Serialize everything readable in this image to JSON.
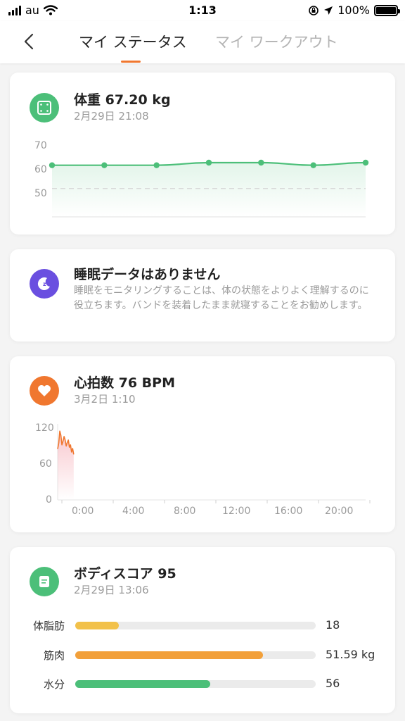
{
  "status_bar": {
    "carrier": "au",
    "time": "1:13",
    "battery_percent": "100%",
    "icons": [
      "signal-icon",
      "wifi-icon",
      "orientation-lock-icon",
      "location-icon",
      "battery-icon"
    ]
  },
  "nav": {
    "back_icon": "chevron-left-icon",
    "tabs": [
      {
        "label": "マイ ステータス",
        "active": true
      },
      {
        "label": "マイ ワークアウト",
        "active": false
      }
    ],
    "accent_color": "#f0772f"
  },
  "weight": {
    "title": "体重 67.20 kg",
    "timestamp": "2月29日 21:08",
    "icon": "scale-icon",
    "color": "#4cbf79",
    "chart_data": {
      "type": "line",
      "yticks": [
        "70",
        "60",
        "50"
      ],
      "ylim": [
        45,
        75
      ],
      "values": [
        65,
        65,
        65,
        66,
        66,
        65,
        66
      ],
      "goal_line": 56
    }
  },
  "sleep": {
    "title": "睡眠データはありません",
    "description": "睡眠をモニタリングすることは、体の状態をよりよく理解するのに役立ちます。バンドを装着したまま就寝することをお勧めします。",
    "icon": "moon-icon",
    "color": "#6a4fe0"
  },
  "heart": {
    "title": "心拍数 76  BPM",
    "timestamp": "3月2日 1:10",
    "icon": "heart-icon",
    "color": "#f0772f",
    "chart_data": {
      "type": "area",
      "yticks": [
        "120",
        "60",
        "0"
      ],
      "ylim": [
        0,
        120
      ],
      "xticks": [
        "0:00",
        "4:00",
        "8:00",
        "12:00",
        "16:00",
        "20:00"
      ],
      "x_minutes": [
        0,
        5,
        10,
        15,
        20,
        25,
        30,
        35,
        40,
        45,
        50,
        55,
        60,
        65,
        70,
        75
      ],
      "values": [
        85,
        95,
        115,
        108,
        92,
        98,
        106,
        100,
        90,
        96,
        100,
        88,
        92,
        80,
        86,
        76
      ]
    }
  },
  "body_score": {
    "title": "ボディスコア 95",
    "timestamp": "2月29日 13:06",
    "icon": "document-icon",
    "color": "#4cbf79",
    "metrics": [
      {
        "label": "体脂肪",
        "value": "18",
        "fill": 0.18,
        "color": "#f2c14a"
      },
      {
        "label": "筋肉",
        "value": "51.59 kg",
        "fill": 0.78,
        "color": "#f2a03a"
      },
      {
        "label": "水分",
        "value": "56",
        "fill": 0.56,
        "color": "#4cbf79"
      }
    ]
  }
}
